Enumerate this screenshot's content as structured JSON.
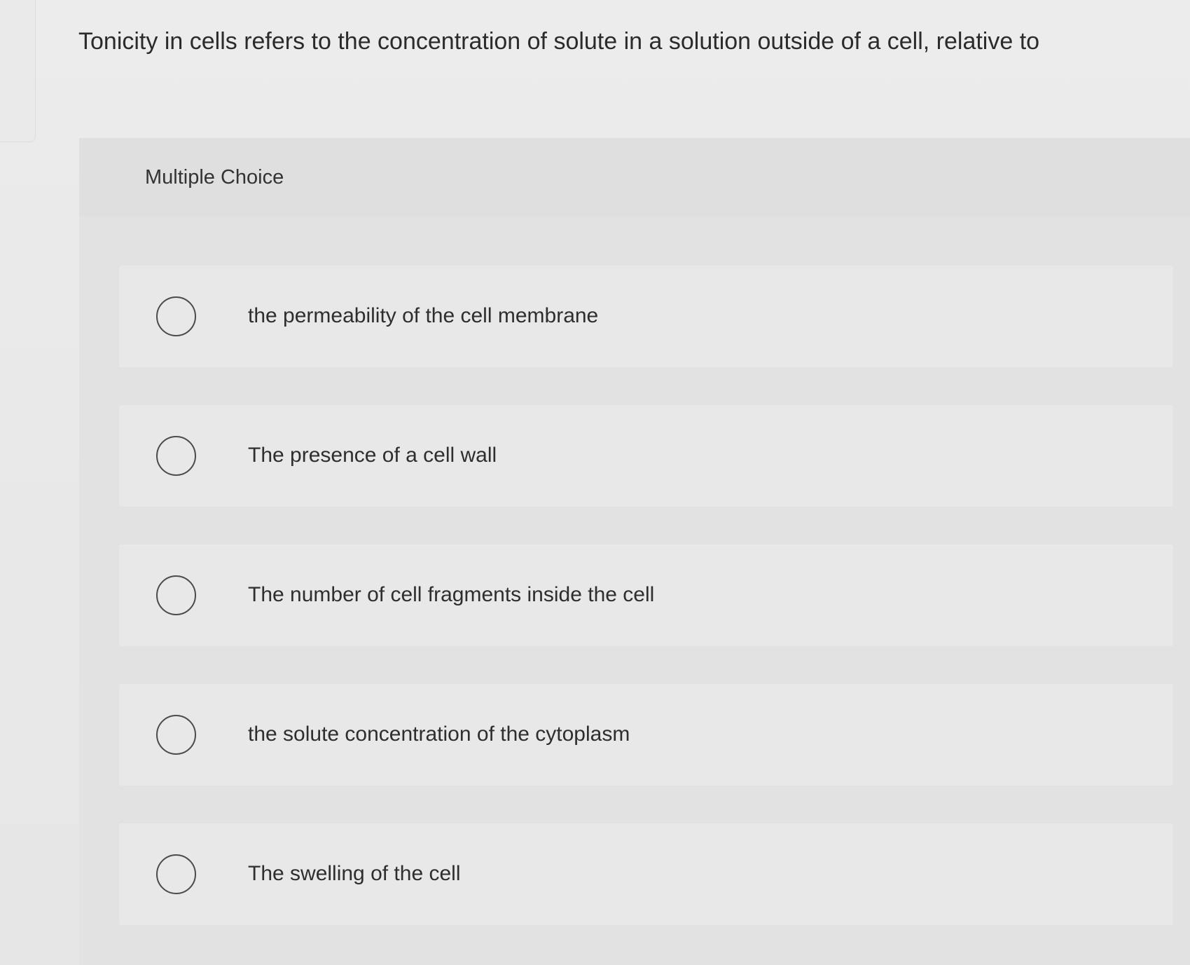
{
  "question": {
    "text": "Tonicity in cells refers to the concentration of solute in a solution outside of a cell, relative to"
  },
  "panel": {
    "title": "Multiple Choice"
  },
  "choices": [
    {
      "label": "the permeability of the cell membrane"
    },
    {
      "label": "The presence of a cell wall"
    },
    {
      "label": "The number of cell fragments inside the cell"
    },
    {
      "label": "the solute concentration of the cytoplasm"
    },
    {
      "label": "The swelling of the cell"
    }
  ],
  "icons": {
    "radio": "radio-button-unselected-icon"
  }
}
